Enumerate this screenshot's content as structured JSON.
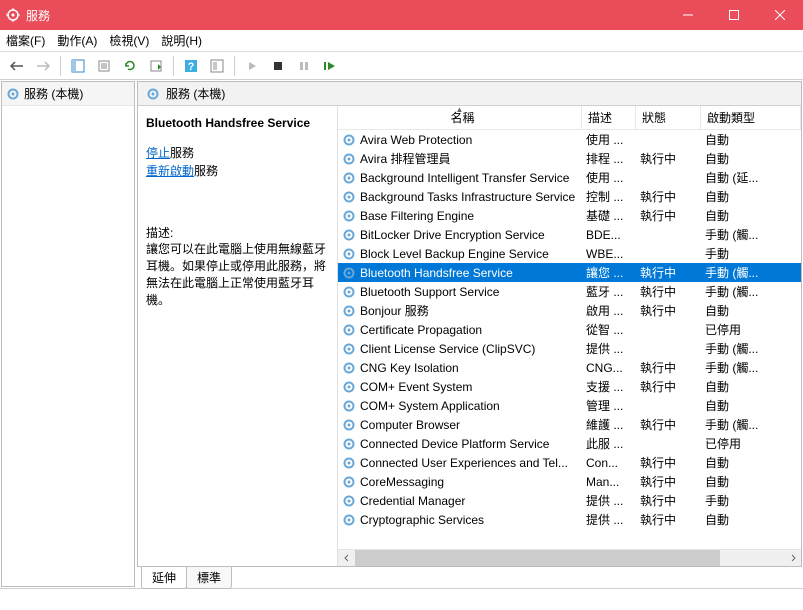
{
  "window": {
    "title": "服務"
  },
  "menus": {
    "file": "檔案(F)",
    "action": "動作(A)",
    "view": "檢視(V)",
    "help": "說明(H)"
  },
  "tree": {
    "root": "服務 (本機)"
  },
  "panel_header": "服務 (本機)",
  "selected": {
    "name": "Bluetooth Handsfree Service",
    "stop_link_label": "停止",
    "stop_link_suffix": "服務",
    "restart_link_label": "重新啟動",
    "restart_link_suffix": "服務",
    "desc_label": "描述:",
    "description": "讓您可以在此電腦上使用無線藍牙耳機。如果停止或停用此服務，將無法在此電腦上正常使用藍牙耳機。"
  },
  "columns": {
    "name": "名稱",
    "desc": "描述",
    "status": "狀態",
    "startup": "啟動類型"
  },
  "services": [
    {
      "name": "Avira Web Protection",
      "desc": "使用 ...",
      "status": "",
      "startup": "自動",
      "sel": false
    },
    {
      "name": "Avira 排程管理員",
      "desc": "排程 ...",
      "status": "執行中",
      "startup": "自動",
      "sel": false
    },
    {
      "name": "Background Intelligent Transfer Service",
      "desc": "使用 ...",
      "status": "",
      "startup": "自動 (延...",
      "sel": false
    },
    {
      "name": "Background Tasks Infrastructure Service",
      "desc": "控制 ...",
      "status": "執行中",
      "startup": "自動",
      "sel": false
    },
    {
      "name": "Base Filtering Engine",
      "desc": "基礎 ...",
      "status": "執行中",
      "startup": "自動",
      "sel": false
    },
    {
      "name": "BitLocker Drive Encryption Service",
      "desc": "BDE...",
      "status": "",
      "startup": "手動 (觸...",
      "sel": false
    },
    {
      "name": "Block Level Backup Engine Service",
      "desc": "WBE...",
      "status": "",
      "startup": "手動",
      "sel": false
    },
    {
      "name": "Bluetooth Handsfree Service",
      "desc": "讓您 ...",
      "status": "執行中",
      "startup": "手動 (觸...",
      "sel": true
    },
    {
      "name": "Bluetooth Support Service",
      "desc": "藍牙 ...",
      "status": "執行中",
      "startup": "手動 (觸...",
      "sel": false
    },
    {
      "name": "Bonjour 服務",
      "desc": "啟用 ...",
      "status": "執行中",
      "startup": "自動",
      "sel": false
    },
    {
      "name": "Certificate Propagation",
      "desc": "從智 ...",
      "status": "",
      "startup": "已停用",
      "sel": false
    },
    {
      "name": "Client License Service (ClipSVC)",
      "desc": "提供 ...",
      "status": "",
      "startup": "手動 (觸...",
      "sel": false
    },
    {
      "name": "CNG Key Isolation",
      "desc": "CNG...",
      "status": "執行中",
      "startup": "手動 (觸...",
      "sel": false
    },
    {
      "name": "COM+ Event System",
      "desc": "支援 ...",
      "status": "執行中",
      "startup": "自動",
      "sel": false
    },
    {
      "name": "COM+ System Application",
      "desc": "管理 ...",
      "status": "",
      "startup": "自動",
      "sel": false
    },
    {
      "name": "Computer Browser",
      "desc": "維護 ...",
      "status": "執行中",
      "startup": "手動 (觸...",
      "sel": false
    },
    {
      "name": "Connected Device Platform Service",
      "desc": "此服 ...",
      "status": "",
      "startup": "已停用",
      "sel": false
    },
    {
      "name": "Connected User Experiences and Tel...",
      "desc": "Con...",
      "status": "執行中",
      "startup": "自動",
      "sel": false
    },
    {
      "name": "CoreMessaging",
      "desc": "Man...",
      "status": "執行中",
      "startup": "自動",
      "sel": false
    },
    {
      "name": "Credential Manager",
      "desc": "提供 ...",
      "status": "執行中",
      "startup": "手動",
      "sel": false
    },
    {
      "name": "Cryptographic Services",
      "desc": "提供 ...",
      "status": "執行中",
      "startup": "自動",
      "sel": false
    }
  ],
  "tabs": {
    "extended": "延伸",
    "standard": "標準"
  }
}
